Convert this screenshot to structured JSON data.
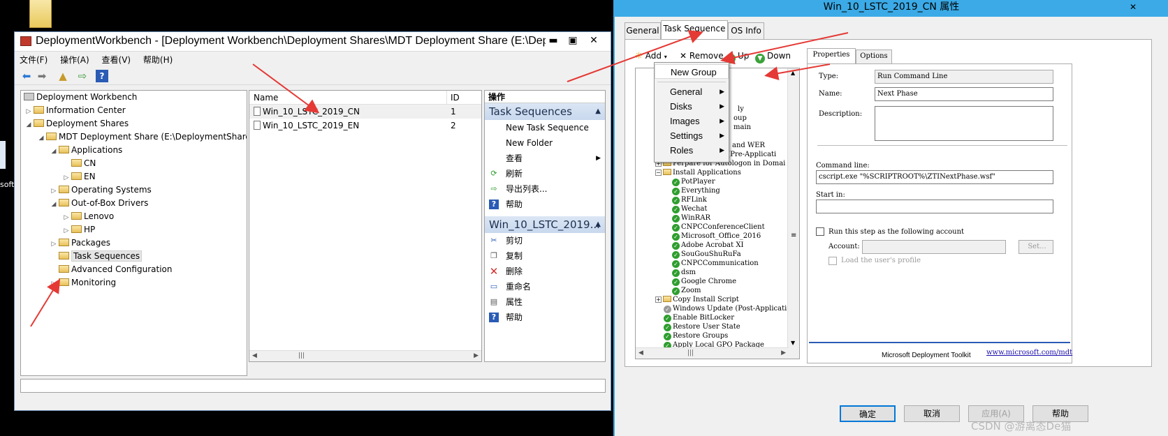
{
  "desktop": {
    "partial_label": "soft"
  },
  "workbench": {
    "title": "DeploymentWorkbench - [Deployment Workbench\\Deployment Shares\\MDT Deployment Share (E:\\Depl...",
    "menu": [
      "文件(F)",
      "操作(A)",
      "查看(V)",
      "帮助(H)"
    ],
    "tree": [
      {
        "label": "Deployment Workbench"
      },
      {
        "label": "Information Center"
      },
      {
        "label": "Deployment Shares"
      },
      {
        "label": "MDT Deployment Share (E:\\DeploymentShare)"
      },
      {
        "label": "Applications"
      },
      {
        "label": "CN"
      },
      {
        "label": "EN"
      },
      {
        "label": "Operating Systems"
      },
      {
        "label": "Out-of-Box Drivers"
      },
      {
        "label": "Lenovo"
      },
      {
        "label": "HP"
      },
      {
        "label": "Packages"
      },
      {
        "label": "Task Sequences"
      },
      {
        "label": "Advanced Configuration"
      },
      {
        "label": "Monitoring"
      }
    ],
    "list": {
      "columns": [
        "Name",
        "ID"
      ],
      "rows": [
        {
          "name": "Win_10_LSTC_2019_CN",
          "id": "1"
        },
        {
          "name": "Win_10_LSTC_2019_EN",
          "id": "2"
        }
      ]
    },
    "actions": {
      "header": "操作",
      "section1": "Task Sequences",
      "section1_items": [
        "New Task Sequence",
        "New Folder",
        "查看",
        "刷新",
        "导出列表...",
        "帮助"
      ],
      "section2": "Win_10_LSTC_2019...",
      "section2_items": [
        "剪切",
        "复制",
        "删除",
        "重命名",
        "属性",
        "帮助"
      ]
    }
  },
  "dialog": {
    "title": "Win_10_LSTC_2019_CN 属性",
    "close": "✕",
    "tabs": [
      "General",
      "Task Sequence",
      "OS Info"
    ],
    "toolbar": {
      "add": "Add",
      "remove": "Remove",
      "up": "Up",
      "down": "Down"
    },
    "add_menu": [
      "New Group",
      "General",
      "Disks",
      "Images",
      "Settings",
      "Roles"
    ],
    "ts_partial": [
      "ly",
      "oup",
      "main",
      "and WER",
      "Windows Update (Pre-Applicati"
    ],
    "ts_tree": [
      "Perpare for Autologon in Domai",
      "Install Applications",
      "PotPlayer",
      "Everything",
      "RFLink",
      "Wechat",
      "WinRAR",
      "CNPCConferenceClient",
      "Microsoft_Office_2016",
      "Adobe Acrobat XI",
      "SouGouShuRuFa",
      "CNPCCommunication",
      "dsm",
      "Google Chrome",
      "Zoom",
      "Copy Install Script",
      "Windows Update (Post-Applicati",
      "Enable BitLocker",
      "Restore User State",
      "Restore Groups",
      "Apply Local GPO Package"
    ],
    "prop_tabs": [
      "Properties",
      "Options"
    ],
    "props": {
      "type_label": "Type:",
      "type_value": "Run Command Line",
      "name_label": "Name:",
      "name_value": "Next Phase",
      "desc_label": "Description:",
      "cmd_label": "Command line:",
      "cmd_value": "cscript.exe \"%SCRIPTROOT%\\ZTINextPhase.wsf\"",
      "start_label": "Start in:",
      "runas_label": "Run this step as the following account",
      "account_label": "Account:",
      "set_button": "Set...",
      "load_profile_label": "Load the user's profile",
      "footer_text": "Microsoft Deployment Toolkit",
      "footer_link": "www.microsoft.com/mdt"
    },
    "buttons": {
      "ok": "确定",
      "cancel": "取消",
      "apply": "应用(A)",
      "help": "帮助"
    }
  },
  "watermark": "CSDN @游离态De猫",
  "colors": {
    "dialog_titlebar": "#3baae6",
    "arrow": "#e53935",
    "selection": "#dbe6f4"
  }
}
